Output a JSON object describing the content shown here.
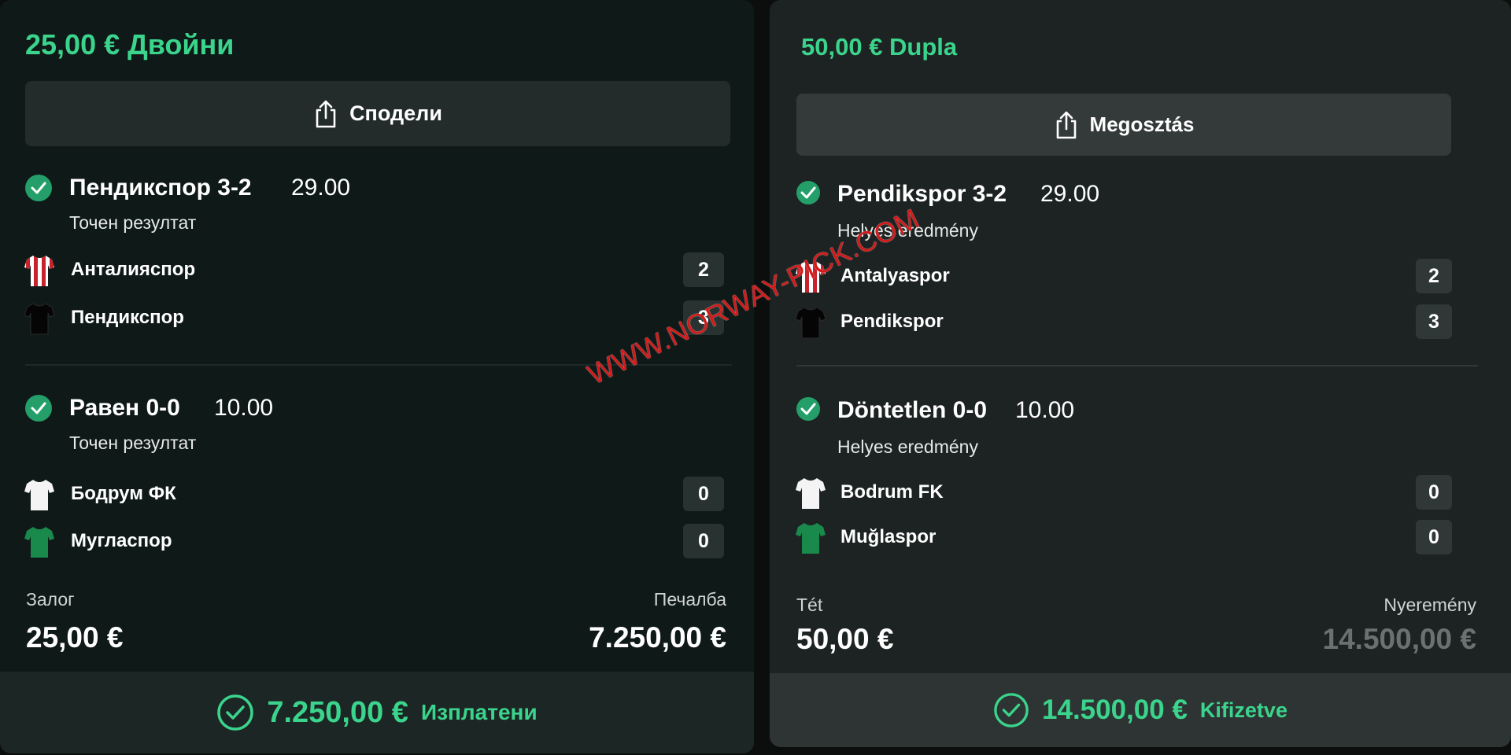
{
  "left": {
    "title": "25,00 € Двойни",
    "share_label": "Сподели",
    "selections": [
      {
        "pick": "Пендикспор 3-2",
        "odds": "29.00",
        "market": "Точен резултат",
        "teams": [
          {
            "name": "Анталияспор",
            "score": "2",
            "kit": "red-white-stripes"
          },
          {
            "name": "Пендикспор",
            "score": "3",
            "kit": "black"
          }
        ]
      },
      {
        "pick": "Равен 0-0",
        "odds": "10.00",
        "market": "Точен резултат",
        "teams": [
          {
            "name": "Бодрум ФК",
            "score": "0",
            "kit": "white"
          },
          {
            "name": "Мугласпор",
            "score": "0",
            "kit": "green"
          }
        ]
      }
    ],
    "stake_label": "Залог",
    "stake_value": "25,00 €",
    "win_label": "Печалба",
    "win_value": "7.250,00 €",
    "payout_amount": "7.250,00 €",
    "payout_status": "Изплатени"
  },
  "right": {
    "title": "50,00 € Dupla",
    "share_label": "Megosztás",
    "selections": [
      {
        "pick": "Pendikspor 3-2",
        "odds": "29.00",
        "market": "Helyes eredmény",
        "teams": [
          {
            "name": "Antalyaspor",
            "score": "2",
            "kit": "red-white-stripes"
          },
          {
            "name": "Pendikspor",
            "score": "3",
            "kit": "black"
          }
        ]
      },
      {
        "pick": "Döntetlen 0-0",
        "odds": "10.00",
        "market": "Helyes eredmény",
        "teams": [
          {
            "name": "Bodrum FK",
            "score": "0",
            "kit": "white"
          },
          {
            "name": "Muğlaspor",
            "score": "0",
            "kit": "green"
          }
        ]
      }
    ],
    "stake_label": "Tét",
    "stake_value": "50,00 €",
    "win_label": "Nyeremény",
    "win_value": "14.500,00 €",
    "payout_amount": "14.500,00 €",
    "payout_status": "Kifizetve"
  },
  "watermark": "WWW.NORWAY-PICK.COM",
  "colors": {
    "accent": "#3bd48c",
    "check": "#249f6a",
    "left_card": "#0f1918",
    "right_card": "#1d2322",
    "watermark": "#d21a1a"
  }
}
